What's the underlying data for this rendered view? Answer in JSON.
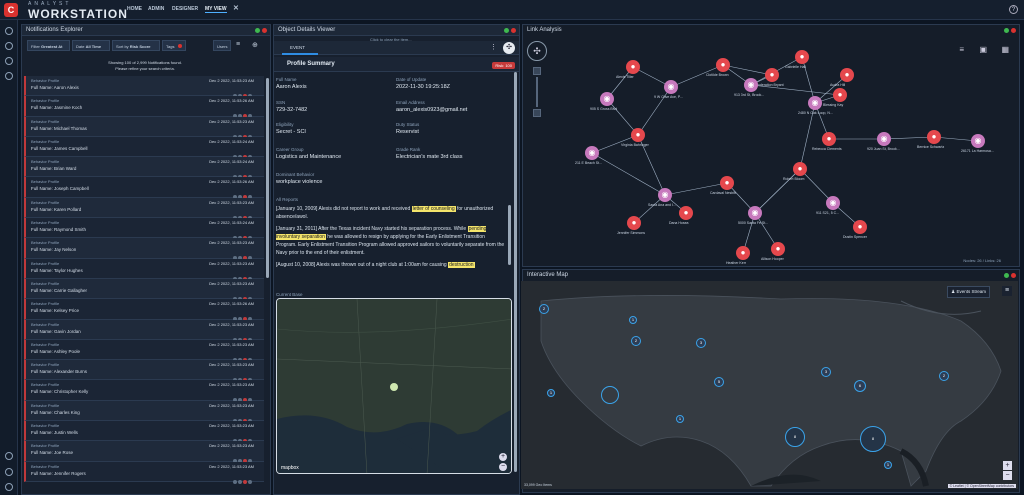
{
  "app": {
    "brand_top": "ANALYST",
    "brand_main": "WORKSTATION",
    "logo_letter": "C"
  },
  "nav": {
    "home": "HOME",
    "admin": "ADMIN",
    "designer": "DESIGNER",
    "my_view": "MY VIEW",
    "close": "✕",
    "help": "?"
  },
  "notifications": {
    "title": "Notifications Explorer",
    "filters": {
      "filter": "Filter",
      "filter_value": "Greatest At",
      "date": "Date",
      "date_value": "All Time",
      "sort": "Sort by",
      "sort_value": "Risk Score",
      "tags": "Tags",
      "users": "Users"
    },
    "showing_line1": "Showing 100 of 2,999 Notifications found.",
    "showing_line2": "Please refine your search criteria.",
    "items": [
      {
        "type": "Behavior Profile",
        "name": "Full Name: Aaron Alexis",
        "date": "Dec 2 2022, 11:53:23 AM"
      },
      {
        "type": "Behavior Profile",
        "name": "Full Name: Jasmine Koch",
        "date": "Dec 2 2022, 11:53:26 AM"
      },
      {
        "type": "Behavior Profile",
        "name": "Full Name: Michael Thomas",
        "date": "Dec 2 2022, 11:53:23 AM"
      },
      {
        "type": "Behavior Profile",
        "name": "Full Name: James Campbell",
        "date": "Dec 2 2022, 11:53:24 AM"
      },
      {
        "type": "Behavior Profile",
        "name": "Full Name: Brian Ward",
        "date": "Dec 2 2022, 11:53:24 AM"
      },
      {
        "type": "Behavior Profile",
        "name": "Full Name: Joseph Campbell",
        "date": "Dec 2 2022, 11:53:26 AM"
      },
      {
        "type": "Behavior Profile",
        "name": "Full Name: Karen Pollard",
        "date": "Dec 2 2022, 11:53:23 AM"
      },
      {
        "type": "Behavior Profile",
        "name": "Full Name: Raymond Smith",
        "date": "Dec 2 2022, 11:53:24 AM"
      },
      {
        "type": "Behavior Profile",
        "name": "Full Name: Jay Nelson",
        "date": "Dec 2 2022, 11:53:23 AM"
      },
      {
        "type": "Behavior Profile",
        "name": "Full Name: Taylor Hughes",
        "date": "Dec 2 2022, 11:53:23 AM"
      },
      {
        "type": "Behavior Profile",
        "name": "Full Name: Carrie Gallagher",
        "date": "Dec 2 2022, 11:53:23 AM"
      },
      {
        "type": "Behavior Profile",
        "name": "Full Name: Kelsey Price",
        "date": "Dec 2 2022, 11:53:26 AM"
      },
      {
        "type": "Behavior Profile",
        "name": "Full Name: Gavin Jordan",
        "date": "Dec 2 2022, 11:53:23 AM"
      },
      {
        "type": "Behavior Profile",
        "name": "Full Name: Ashley Poole",
        "date": "Dec 2 2022, 11:53:23 AM"
      },
      {
        "type": "Behavior Profile",
        "name": "Full Name: Alexander Burns",
        "date": "Dec 2 2022, 11:53:23 AM"
      },
      {
        "type": "Behavior Profile",
        "name": "Full Name: Christopher Kelly",
        "date": "Dec 2 2022, 11:53:23 AM"
      },
      {
        "type": "Behavior Profile",
        "name": "Full Name: Charles King",
        "date": "Dec 2 2022, 11:53:23 AM"
      },
      {
        "type": "Behavior Profile",
        "name": "Full Name: Justin Wells",
        "date": "Dec 2 2022, 11:53:23 AM"
      },
      {
        "type": "Behavior Profile",
        "name": "Full Name: Joe Rose",
        "date": "Dec 2 2022, 11:53:23 AM"
      },
      {
        "type": "Behavior Profile",
        "name": "Full Name: Jennifer Rogers",
        "date": "Dec 2 2022, 11:53:23 AM"
      }
    ]
  },
  "object_details": {
    "title": "Object Details Viewer",
    "click_hint": "Click to clear the item...",
    "tab_event": "EVENT",
    "profile_summary": "Profile Summary",
    "risk": "Risk: 100",
    "fields": [
      {
        "label": "Full Name",
        "value": "Aaron Alexis"
      },
      {
        "label": "Date of Update",
        "value": "2022-11-30 19:25:18Z"
      },
      {
        "label": "SSN",
        "value": "729-32-7482"
      },
      {
        "label": "Email Address",
        "value": "aaron_alexis0923@gmail.net"
      },
      {
        "label": "Eligibility",
        "value": "Secret - SCI"
      },
      {
        "label": "Duty Status",
        "value": "Reservist"
      },
      {
        "label": "Career Group",
        "value": "Logistics and Maintenance"
      },
      {
        "label": "Grade Rank",
        "value": "Electrician's mate 3rd class"
      },
      {
        "label": "Dominant Behavior",
        "value": "workplace violence"
      }
    ],
    "all_reports": "All Reports",
    "reports": [
      {
        "before": "[January 10, 2009] Alexis did not report to work and received ",
        "hl": "letter of counseling",
        "after": " for unauthorized absence/awol."
      },
      {
        "before": "[January 31, 2011] After the Texas incident Navy started his separation process. While ",
        "hl": "pending involuntary separation",
        "after": " he was allowed to resign by applying for the Early Enlistment Transition Program. Early Enlistment Transition Program allowed approved sailors to voluntarily separate from the Navy prior to the end of their enlistment."
      },
      {
        "before": "[August 10, 2008] Alexis was thrown out of a night club at 1:00am for causing ",
        "hl": "destruction",
        "after": ""
      }
    ],
    "current_base": "Current Base",
    "map_logo": "mapbox"
  },
  "link_analysis": {
    "title": "Link Analysis",
    "footer": "Nodes: 26 / Links: 26",
    "labels": [
      "Alexis Tiller",
      "Clotilde Brown",
      "Moderation Bryant",
      "Gabrielle Hall",
      "Audra Hill",
      "905 S Gross Blvd",
      "9 W Olive Ave, P...",
      "913 3rd St, Brook...",
      "Blessing Kay",
      "2480 N Oak Loop, N...",
      "Virginia Bahringer",
      "Rebecca Clements",
      "920 Juan St, Brook...",
      "Bernice Schwartz",
      "26171 La Harmosa...",
      "211 E Beach St...",
      "Robert Bloom",
      "Santa Ana and I...",
      "Cardaval Nesbitt",
      "911 S21, 5 C...",
      "Dana Hosea",
      "5000 Santa Fe St...",
      "Jennifer Simmons",
      "Heather Kerr",
      "Allison Hooper",
      "Dustin Spencer"
    ]
  },
  "interactive_map": {
    "title": "Interactive Map",
    "events_stream": "Events Stream",
    "footer_left": "33,099 Geo Items",
    "attribution": "© Leaflet | © OpenStreetMap contributors"
  },
  "colors": {
    "accent": "#2f8de4",
    "person": "#e5484d",
    "location": "#c779bd",
    "risk": "#c73a3a",
    "highlight": "#f4e56b"
  }
}
